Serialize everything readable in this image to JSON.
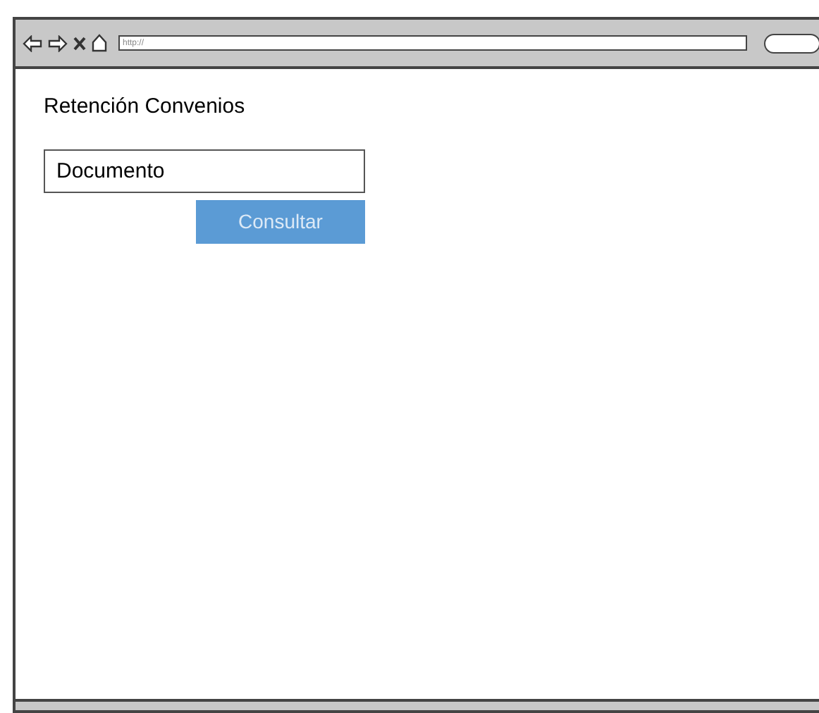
{
  "browser": {
    "address": "http://"
  },
  "page": {
    "title": "Retención Convenios",
    "field": {
      "value": "Documento"
    },
    "button": "Consultar"
  }
}
